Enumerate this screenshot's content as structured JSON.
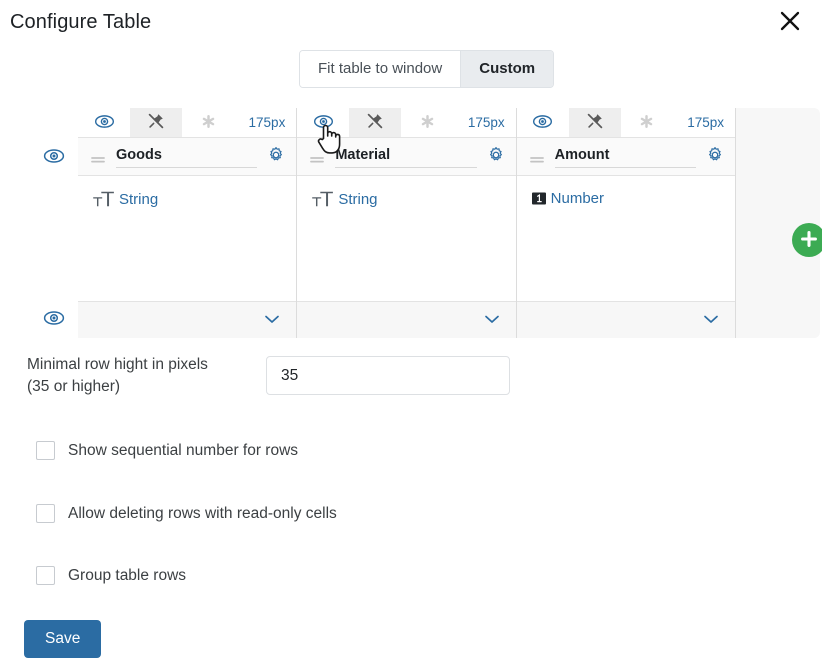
{
  "dialog": {
    "title": "Configure Table",
    "close_icon": "close-icon"
  },
  "view_mode": {
    "options": [
      {
        "label": "Fit table to window",
        "active": false
      },
      {
        "label": "Custom",
        "active": true
      }
    ]
  },
  "table_config": {
    "row_visibility_icon": "eye-icon",
    "columns": [
      {
        "name": "Goods",
        "width_label": "175px",
        "visibility_icon": "eye-icon",
        "pin_icon": "unpin-icon",
        "required_icon": "asterisk-icon",
        "drag_handle_icon": "drag-handle-icon",
        "settings_icon": "gear-icon",
        "type_label": "String",
        "type_icon": "text-type-icon",
        "footer_icon": "chevron-down-icon"
      },
      {
        "name": "Material",
        "width_label": "175px",
        "visibility_icon": "eye-icon",
        "pin_icon": "unpin-icon",
        "required_icon": "asterisk-icon",
        "drag_handle_icon": "drag-handle-icon",
        "settings_icon": "gear-icon",
        "type_label": "String",
        "type_icon": "text-type-icon",
        "footer_icon": "chevron-down-icon"
      },
      {
        "name": "Amount",
        "width_label": "175px",
        "visibility_icon": "eye-icon",
        "pin_icon": "unpin-icon",
        "required_icon": "asterisk-icon",
        "drag_handle_icon": "drag-handle-icon",
        "settings_icon": "gear-icon",
        "type_label": "Number",
        "type_icon": "number-type-icon",
        "footer_icon": "chevron-down-icon"
      }
    ],
    "add_column": {
      "icon": "plus-icon",
      "color": "#3cab53"
    }
  },
  "min_row_height": {
    "label_line1": "Minimal row hight in pixels",
    "label_line2": "(35 or higher)",
    "value": "35",
    "placeholder": "35"
  },
  "options": [
    {
      "label": "Show sequential number for rows",
      "checked": false
    },
    {
      "label": "Allow deleting rows with read-only cells",
      "checked": false
    },
    {
      "label": "Group table rows",
      "checked": false
    }
  ],
  "footer": {
    "save_label": "Save",
    "save_color": "#2b6ca3"
  },
  "cursor": {
    "icon": "pointer-hand-cursor"
  }
}
